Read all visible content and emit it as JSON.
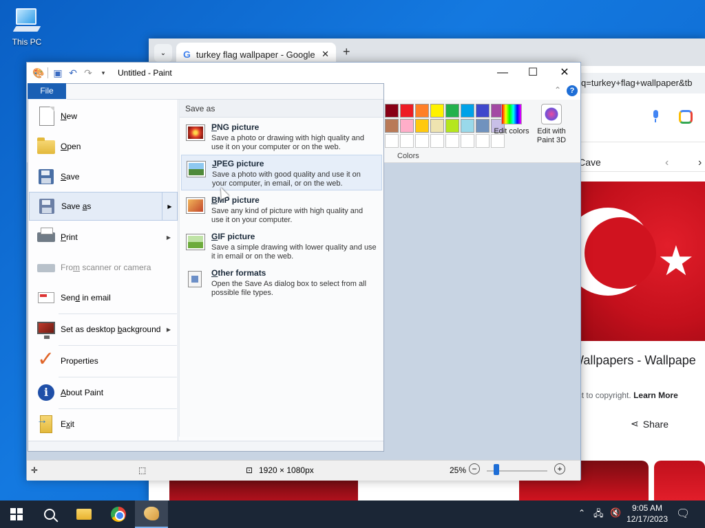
{
  "desktop": {
    "this_pc_label": "This PC"
  },
  "chrome": {
    "tab_title": "turkey flag wallpaper - Google",
    "tab_close": "✕",
    "tab_dropdown": "⌄",
    "new_tab": "+",
    "url_fragment": "q=turkey+flag+wallpaper&tb",
    "source_name": "per Cave",
    "result_title": "g Wallpapers - Wallpape",
    "copyright_text": "ubject to copyright.",
    "learn_more": "Learn More",
    "share": "Share",
    "prev_arrow": "‹",
    "next_arrow": "›"
  },
  "paint": {
    "window_title": "Untitled - Paint",
    "minimize": "—",
    "maximize": "☐",
    "close": "✕",
    "collapse_ribbon": "⌃",
    "help": "?",
    "colors_label": "Colors",
    "edit_colors": "Edit colors",
    "edit_paint3d": "Edit with Paint 3D",
    "status": {
      "dimensions": "1920 × 1080px",
      "zoom": "25%",
      "zoom_out": "−",
      "zoom_in": "+",
      "zoom_level": 0.25
    },
    "swatch_colors_row1": [
      "#880015",
      "#ed1c24",
      "#ff7f27",
      "#fff200",
      "#22b14c",
      "#00a2e8",
      "#3f48cc",
      "#a349a4"
    ],
    "swatch_colors_row2": [
      "#b97a57",
      "#ffaec9",
      "#ffc90e",
      "#efe4b0",
      "#b5e61d",
      "#99d9ea",
      "#7092be",
      "#c8bfe7"
    ]
  },
  "file_menu": {
    "file_tab": "File",
    "items": [
      {
        "label": "New",
        "ul": "N",
        "rest": "ew"
      },
      {
        "label": "Open",
        "ul": "O",
        "rest": "pen"
      },
      {
        "label": "Save",
        "ul": "S",
        "rest": "ave"
      },
      {
        "label": "Save as",
        "pre": "Save ",
        "ul": "a",
        "rest": "s"
      },
      {
        "label": "Print",
        "ul": "P",
        "rest": "rint"
      },
      {
        "label": "From scanner or camera",
        "pre": "Fro",
        "ul": "m",
        "rest": " scanner or camera"
      },
      {
        "label": "Send in email",
        "pre": "Sen",
        "ul": "d",
        "rest": " in email"
      },
      {
        "label": "Set as desktop background",
        "pre": "Set as desktop ",
        "ul": "b",
        "rest": "ackground"
      },
      {
        "label": "Properties",
        "ul": "P",
        "rest": "roperties"
      },
      {
        "label": "About Paint",
        "pre": "",
        "ul": "A",
        "rest": "bout Paint"
      },
      {
        "label": "Exit",
        "pre": "E",
        "ul": "x",
        "rest": "it"
      }
    ],
    "save_as": {
      "header": "Save as",
      "options": [
        {
          "title_ul": "P",
          "title_rest": "NG picture",
          "desc": "Save a photo or drawing with high quality and use it on your computer or on the web."
        },
        {
          "title_ul": "J",
          "title_rest": "PEG picture",
          "desc": "Save a photo with good quality and use it on your computer, in email, or on the web."
        },
        {
          "title_ul": "B",
          "title_rest": "MP picture",
          "desc": "Save any kind of picture with high quality and use it on your computer."
        },
        {
          "title_ul": "G",
          "title_rest": "IF picture",
          "desc": "Save a simple drawing with lower quality and use it in email or on the web."
        },
        {
          "title_ul": "O",
          "title_rest": "ther formats",
          "desc": "Open the Save As dialog box to select from all possible file types."
        }
      ]
    }
  },
  "taskbar": {
    "time": "9:05 AM",
    "date": "12/17/2023"
  }
}
